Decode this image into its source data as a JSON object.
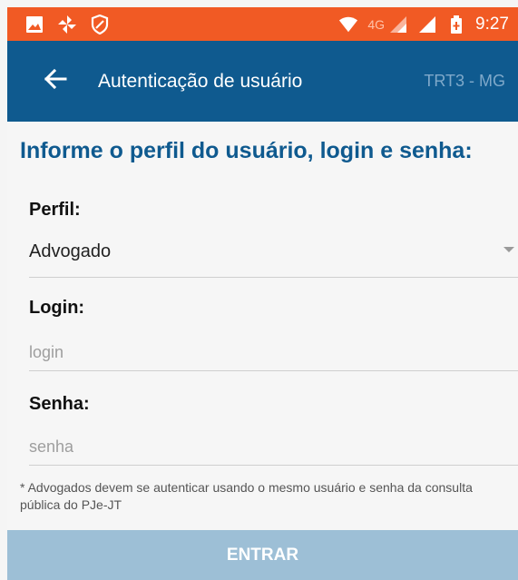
{
  "status_bar": {
    "icons": [
      "image-icon",
      "pinwheel-icon",
      "shield-icon",
      "wifi-icon",
      "signal-icon",
      "signal-icon",
      "battery-icon"
    ],
    "network": "4G",
    "time": "9:27",
    "background_color": "#f15a24"
  },
  "app_bar": {
    "title": "Autenticação de usuário",
    "region": "TRT3 - MG",
    "back_icon": "arrow-left-icon",
    "background_color": "#0f5a8f"
  },
  "form": {
    "heading": "Informe o perfil do usuário, login e senha:",
    "perfil_label": "Perfil:",
    "perfil_value": "Advogado",
    "login_label": "Login:",
    "login_placeholder": "login",
    "senha_label": "Senha:",
    "senha_placeholder": "senha",
    "note": "* Advogados devem se autenticar usando o mesmo usuário e senha da consulta pública do PJe-JT"
  },
  "submit": {
    "label": "ENTRAR",
    "background_color": "#9dbfd6"
  }
}
